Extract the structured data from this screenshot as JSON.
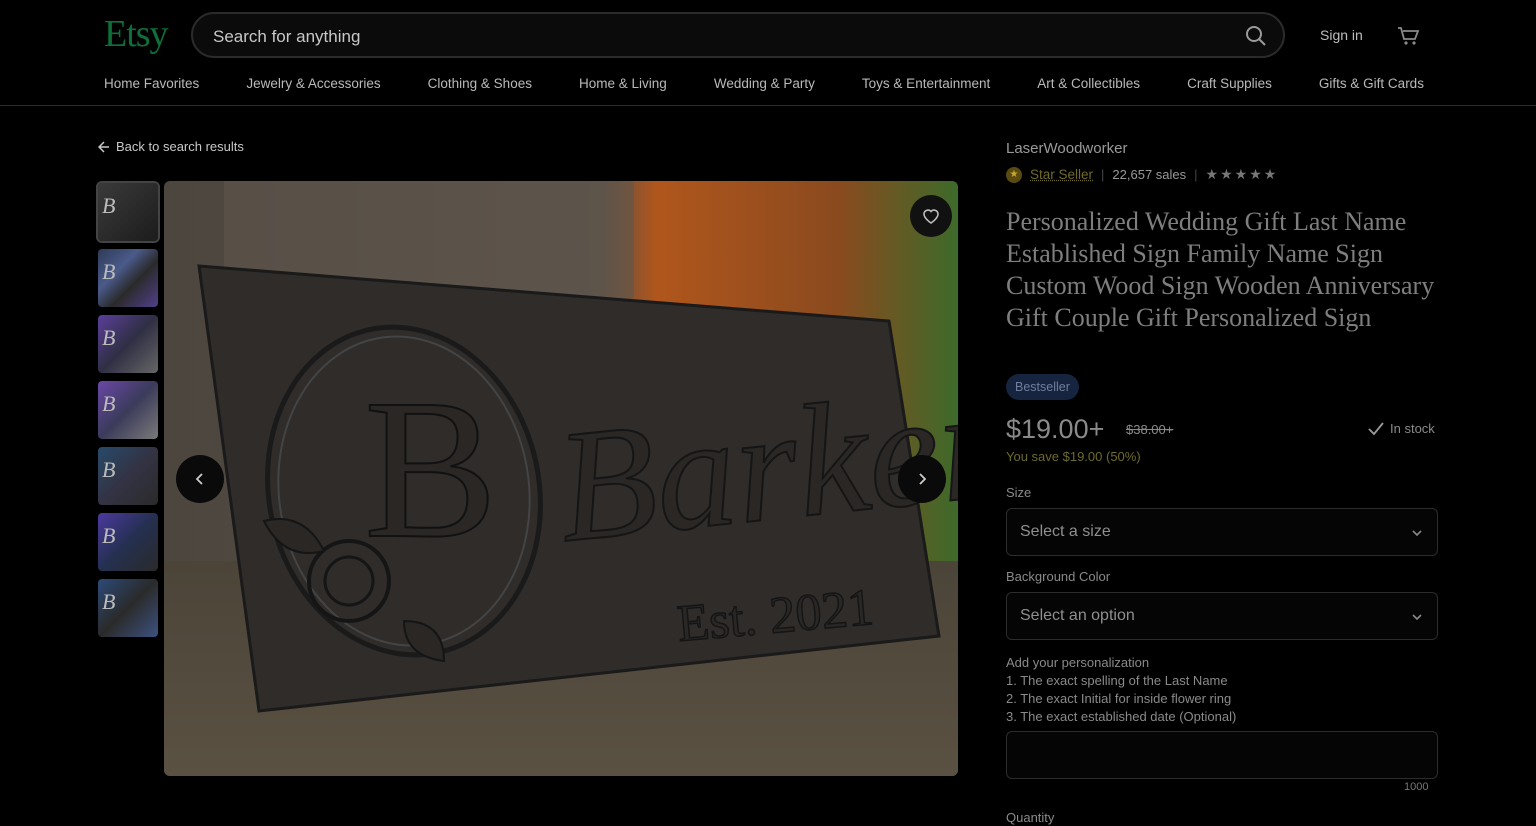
{
  "header": {
    "logo": "Etsy",
    "search_placeholder": "Search for anything",
    "signin": "Sign in",
    "nav": [
      "Home Favorites",
      "Jewelry & Accessories",
      "Clothing & Shoes",
      "Home & Living",
      "Wedding & Party",
      "Toys & Entertainment",
      "Art & Collectibles",
      "Craft Supplies",
      "Gifts & Gift Cards"
    ]
  },
  "back_link": "Back to search results",
  "image": {
    "main_initial": "B",
    "main_name": "Barker",
    "main_est": "Est. 2021"
  },
  "shop": {
    "name": "LaserWoodworker",
    "badge": "Star Seller",
    "sales": "22,657 sales",
    "stars": "★★★★★"
  },
  "product": {
    "title": "Personalized Wedding Gift Last Name Established Sign Family Name Sign Custom Wood Sign Wooden Anniversary Gift Couple Gift Personalized Sign",
    "badge": "Bestseller",
    "price": "$19.00+",
    "old_price": "$38.00+",
    "stock": "In stock",
    "savings": "You save $19.00 (50%)"
  },
  "options": {
    "size_label": "Size",
    "size_value": "Select a size",
    "color_label": "Background Color",
    "color_value": "Select an option"
  },
  "personalization": {
    "label": "Add your personalization",
    "line1": "1. The exact spelling of the Last Name",
    "line2": "2. The exact Initial for inside flower ring",
    "line3": "3. The exact established date (Optional)",
    "counter": "1000"
  },
  "quantity_label": "Quantity"
}
